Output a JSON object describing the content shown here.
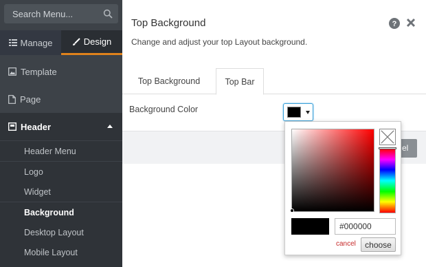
{
  "sidebar": {
    "search_placeholder": "Search Menu...",
    "tabs": {
      "manage": "Manage",
      "design": "Design"
    },
    "items": {
      "template": "Template",
      "page": "Page",
      "header": "Header"
    },
    "header_sub": [
      "Header Menu",
      "Logo",
      "Widget",
      "Background",
      "Desktop Layout",
      "Mobile Layout"
    ],
    "active_sub": "Background",
    "accent_color": "#e0821b"
  },
  "panel": {
    "title": "Top Background",
    "description": "Change and adjust your top Layout background.",
    "tabs": [
      "Top Background",
      "Top Bar"
    ],
    "active_tab": "Top Bar",
    "field_label": "Background Color",
    "behind_button_fragment": "el"
  },
  "color_picker": {
    "current_color": "#000000",
    "hex_value": "#000000",
    "cancel_label": "cancel",
    "choose_label": "choose"
  }
}
